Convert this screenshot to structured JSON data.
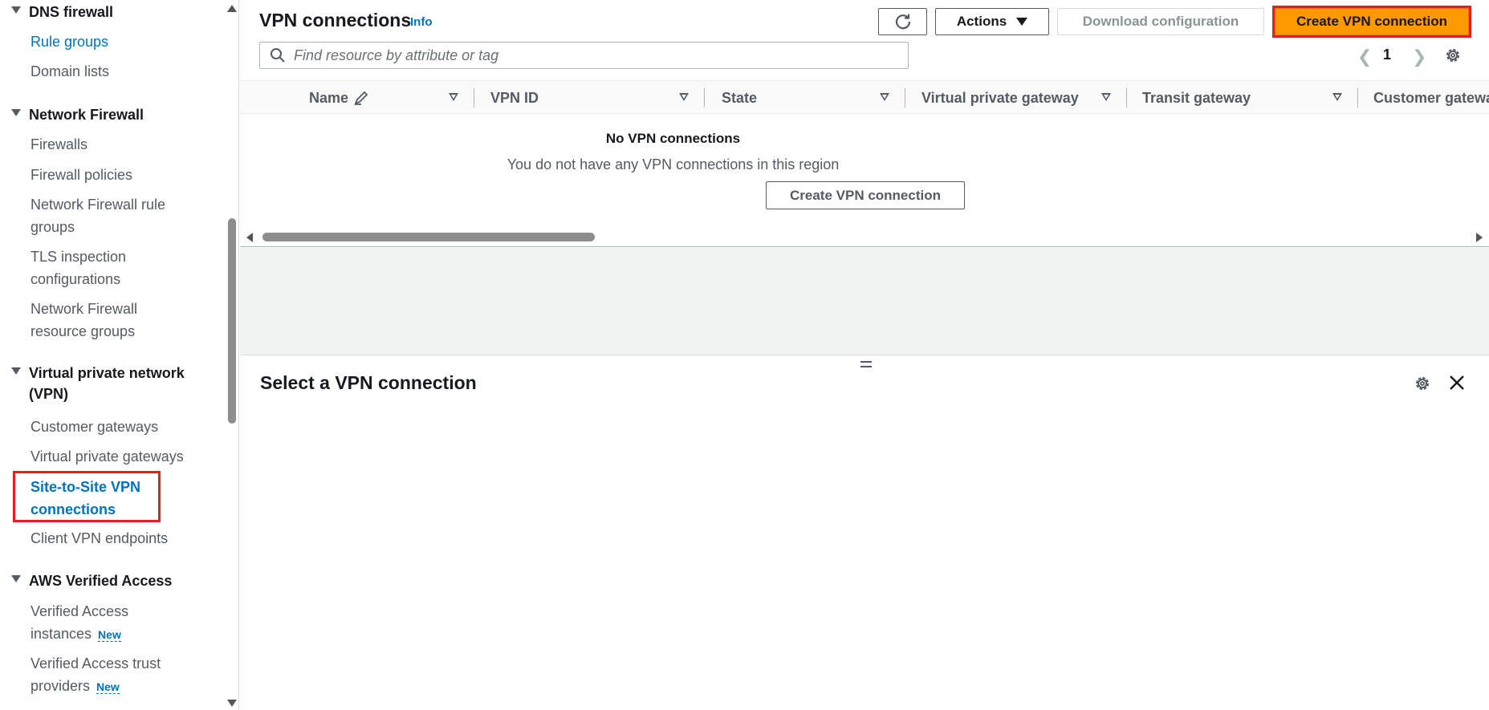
{
  "sidebar": {
    "sections": [
      {
        "label": "DNS firewall"
      },
      {
        "label": "Network Firewall"
      },
      {
        "label": "Virtual private network (VPN)"
      },
      {
        "label": "AWS Verified Access"
      }
    ],
    "items": [
      {
        "label": "Rule groups"
      },
      {
        "label": "Domain lists"
      },
      {
        "label": "Firewalls"
      },
      {
        "label": "Firewall policies"
      },
      {
        "label": "Network Firewall rule groups"
      },
      {
        "label": "TLS inspection configurations"
      },
      {
        "label": "Network Firewall resource groups"
      },
      {
        "label": "Customer gateways"
      },
      {
        "label": "Virtual private gateways"
      },
      {
        "label": "Site-to-Site VPN connections"
      },
      {
        "label": "Client VPN endpoints"
      },
      {
        "label": "Verified Access instances",
        "badge": "New"
      },
      {
        "label": "Verified Access trust providers",
        "badge": "New"
      }
    ]
  },
  "header": {
    "title": "VPN connections",
    "info": "Info",
    "actions_label": "Actions",
    "download_label": "Download configuration",
    "create_label": "Create VPN connection"
  },
  "search": {
    "placeholder": "Find resource by attribute or tag"
  },
  "pagination": {
    "page": "1"
  },
  "table": {
    "columns": [
      "Name",
      "VPN ID",
      "State",
      "Virtual private gateway",
      "Transit gateway",
      "Customer gateway"
    ],
    "empty_title": "No VPN connections",
    "empty_message": "You do not have any VPN connections in this region",
    "empty_button": "Create VPN connection"
  },
  "detail": {
    "title": "Select a VPN connection"
  },
  "colors": {
    "accent": "#0073bb",
    "primary_button": "#ff9900",
    "highlight": "#e02020"
  }
}
